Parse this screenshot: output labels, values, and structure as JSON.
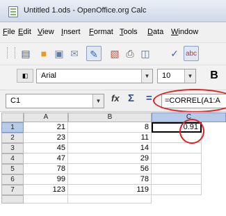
{
  "window": {
    "title": "Untitled 1.ods - OpenOffice.org Calc"
  },
  "menu": [
    "File",
    "Edit",
    "View",
    "Insert",
    "Format",
    "Tools",
    "Data",
    "Window"
  ],
  "toolbar": {
    "font_name": "Arial",
    "font_size": "10",
    "bold_label": "B"
  },
  "formula_bar": {
    "cell_ref": "C1",
    "fx": "fx",
    "sum": "Σ",
    "eq": "=",
    "formula": "=CORREL(A1:A"
  },
  "sheet": {
    "columns": [
      "A",
      "B",
      "C"
    ],
    "rows": [
      {
        "num": "1",
        "a": "21",
        "b": "8",
        "c": "0.91"
      },
      {
        "num": "2",
        "a": "23",
        "b": "11",
        "c": ""
      },
      {
        "num": "3",
        "a": "45",
        "b": "14",
        "c": ""
      },
      {
        "num": "4",
        "a": "47",
        "b": "29",
        "c": ""
      },
      {
        "num": "5",
        "a": "78",
        "b": "56",
        "c": ""
      },
      {
        "num": "6",
        "a": "99",
        "b": "78",
        "c": ""
      },
      {
        "num": "7",
        "a": "123",
        "b": "119",
        "c": ""
      }
    ]
  },
  "highlight_color": "#e02020"
}
